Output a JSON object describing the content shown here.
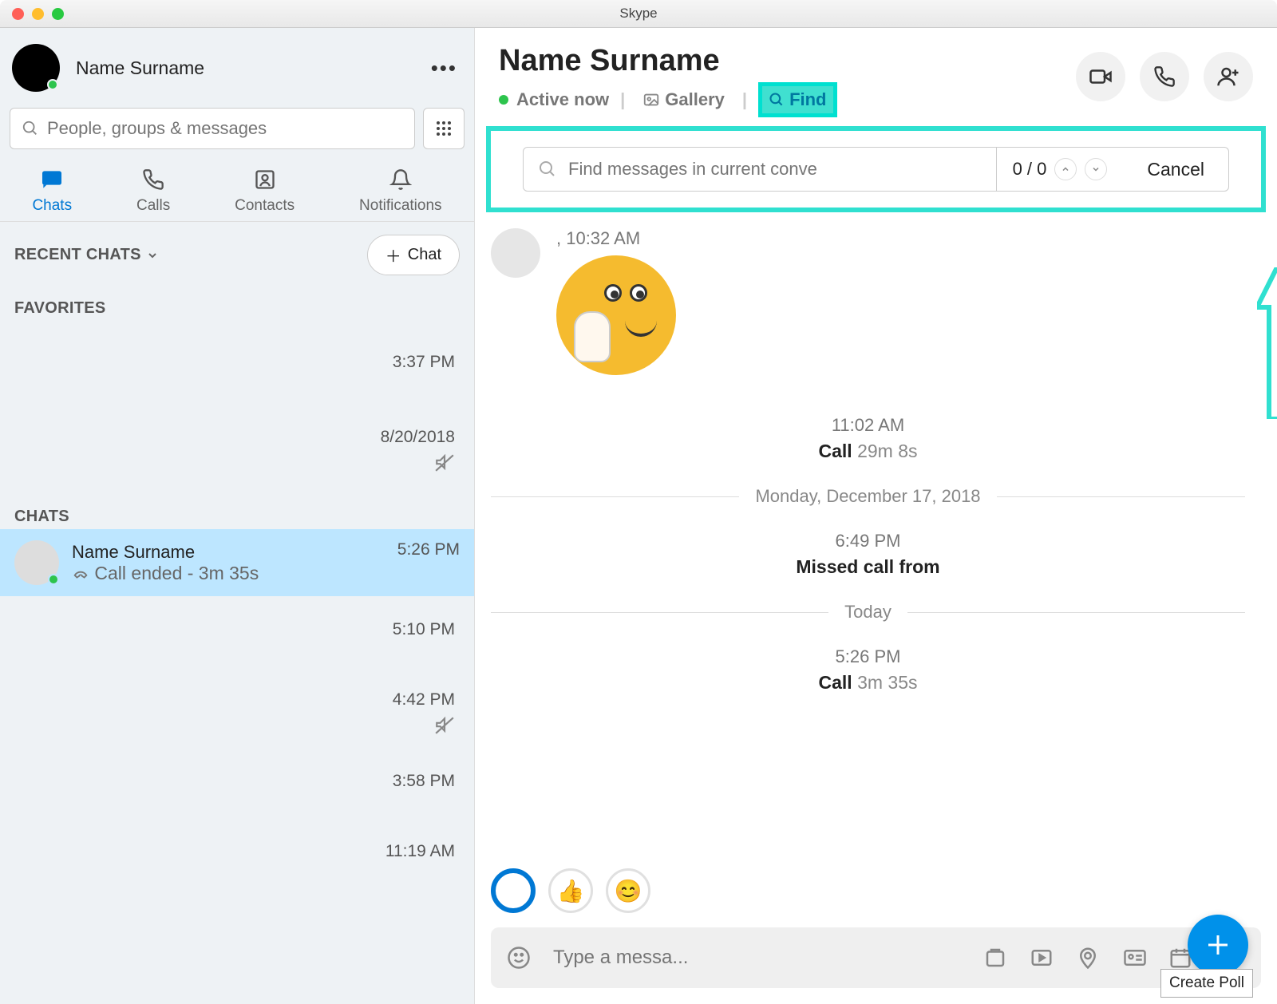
{
  "window": {
    "title": "Skype"
  },
  "profile": {
    "name": "Name Surname"
  },
  "search": {
    "placeholder": "People, groups & messages"
  },
  "nav": {
    "chats": "Chats",
    "calls": "Calls",
    "contacts": "Contacts",
    "notifications": "Notifications"
  },
  "sections": {
    "recent": "RECENT CHATS",
    "favorites": "FAVORITES",
    "chats": "CHATS",
    "chat_btn": "Chat"
  },
  "sidebar_items": {
    "fav1_time": "3:37 PM",
    "fav2_time": "8/20/2018",
    "selected": {
      "name": "Name Surname",
      "sub": "Call ended - 3m 35s",
      "time": "5:26 PM"
    },
    "t1": "5:10 PM",
    "t2": "4:42 PM",
    "t3": "3:58 PM",
    "t4": "11:19 AM"
  },
  "chat_header": {
    "title": "Name Surname",
    "status": "Active now",
    "gallery": "Gallery",
    "find": "Find"
  },
  "find_bar": {
    "placeholder": "Find messages in current conve",
    "count": "0 / 0",
    "cancel": "Cancel"
  },
  "messages": {
    "first_time": ", 10:32 AM",
    "call1_time": "11:02 AM",
    "call1_label": "Call",
    "call1_dur": "29m 8s",
    "date1": "Monday, December 17, 2018",
    "missed_time": "6:49 PM",
    "missed_label": "Missed call from",
    "date2": "Today",
    "call2_time": "5:26 PM",
    "call2_label": "Call",
    "call2_dur": "3m 35s"
  },
  "composer": {
    "placeholder": "Type a messa..."
  },
  "tooltip": "Create Poll"
}
